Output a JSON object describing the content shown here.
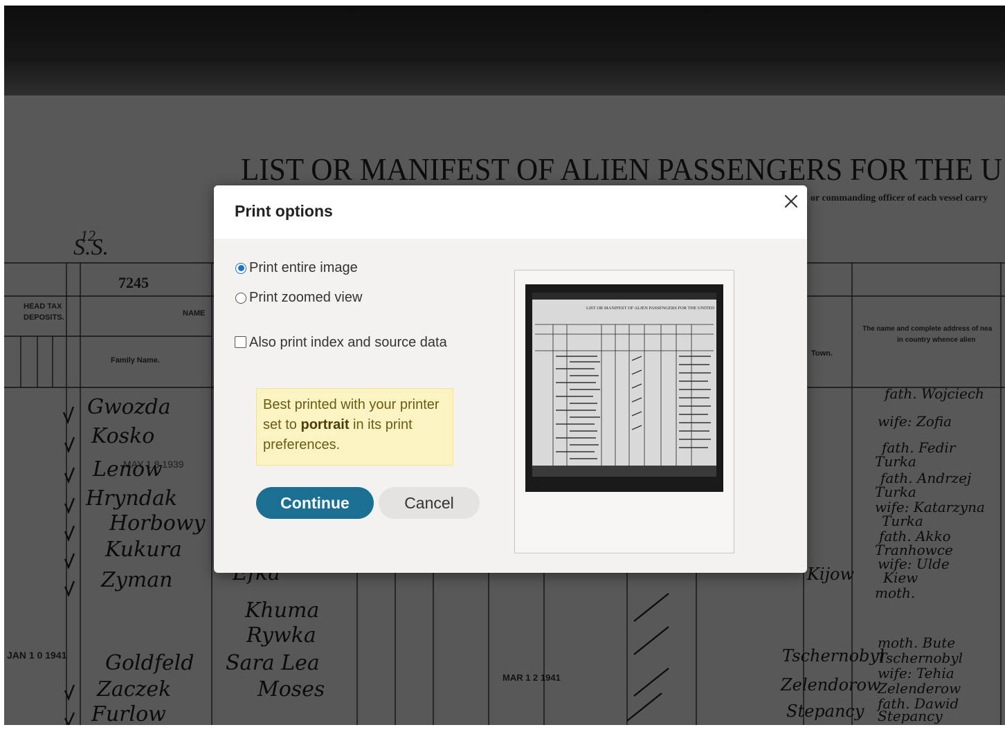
{
  "background": {
    "document_title": "LIST OR MANIFEST OF ALIEN PASSENGERS FOR THE U",
    "right_note": "or commanding officer of each vessel carry",
    "ship_mark": "S.S.",
    "ship_number": "12",
    "manifest_number": "7245",
    "col_head_tax": "HEAD TAX",
    "col_head_deposits": "DEPOSITS.",
    "col_family_name": "Family Name.",
    "col_name": "NAME",
    "col_town": "Town.",
    "col_right_header_1": "The name and complete address of nea",
    "col_right_header_2": "in country whence alien",
    "stamp_1": "MAY 1 8 1939",
    "stamp_2": "JAN 1 0 1941",
    "stamp_3": "MAR 1 2 1941",
    "handwritten_names": [
      "Gwozda",
      "Kosko",
      "Lenow",
      "Hryndak",
      "Horbowy",
      "Kukura",
      "Zyman",
      "Goldfeld",
      "Zaczek",
      "Furlow"
    ],
    "handwritten_given": [
      "Efka",
      "Khuma",
      "Rywka",
      "Sara Lea",
      "Moses"
    ],
    "handwritten_places": [
      "Kijow",
      "Zelendorow",
      "Stepancy",
      "Tschernobyl"
    ],
    "handwritten_notes": [
      "fath. Wojciech",
      "wife: Zofia",
      "fath. Fedir",
      "Turka",
      "fath. Andrzej",
      "Turka",
      "wife: Katarzyna",
      "Turka",
      "fath. Akko",
      "Tranhowce",
      "wife: Ulde",
      "Kiew",
      "moth.",
      "moth. Bute",
      "Tschernobyl",
      "wife: Tehia",
      "Zelenderow",
      "fath. Dawid",
      "Stepancy"
    ]
  },
  "modal": {
    "title": "Print options",
    "close_label": "Close",
    "options": {
      "entire": {
        "label": "Print entire image",
        "checked": true
      },
      "zoomed": {
        "label": "Print zoomed view",
        "checked": false
      },
      "index": {
        "label": "Also print index and source data",
        "checked": false
      }
    },
    "tip": {
      "before": "Best printed with your printer set to ",
      "bold": "portrait",
      "after": " in its print preferences."
    },
    "buttons": {
      "continue": "Continue",
      "cancel": "Cancel"
    },
    "preview": {
      "thumb_title": "LIST OR MANIFEST OF ALIEN PASSENGERS FOR THE UNITED"
    }
  },
  "colors": {
    "primary_button": "#1b6f93",
    "secondary_button": "#e5e3e0",
    "modal_body": "#f4f2ef",
    "tip_background": "#fbf3c2",
    "radio_accent": "#1a73c8"
  }
}
